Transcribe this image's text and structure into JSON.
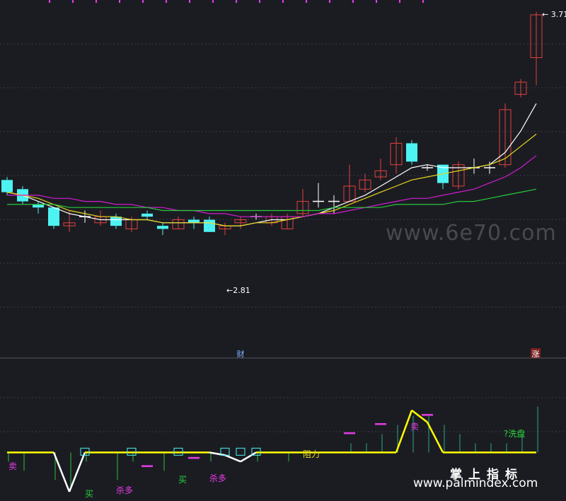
{
  "watermarks": {
    "center": "www.6e70.com",
    "cn": "掌上指标",
    "url": "www.palmindex.com"
  },
  "colors": {
    "background": "#1b1c22",
    "grid": "#3a3d46",
    "up": "#e0413c",
    "down": "#4df2f2",
    "ma_white": "#ffffff",
    "ma_yellow": "#e6d61a",
    "ma_magenta": "#d21bd2",
    "ma_green": "#27c93a",
    "signal_line": "#ffff00",
    "signal_white": "#ffffff",
    "label_magenta": "#e63ce6",
    "label_green": "#27d63a",
    "label_yellow": "#e6d61a",
    "label_caption": "#7fb6ff"
  },
  "chart_data": [
    {
      "type": "candlestick",
      "title": "",
      "ylim": [
        2.62,
        3.74
      ],
      "candles": [
        {
          "o": 3.17,
          "c": 3.13,
          "h": 3.18,
          "l": 3.12
        },
        {
          "o": 3.14,
          "c": 3.1,
          "h": 3.15,
          "l": 3.09
        },
        {
          "o": 3.09,
          "c": 3.08,
          "h": 3.1,
          "l": 3.06
        },
        {
          "o": 3.08,
          "c": 3.02,
          "h": 3.08,
          "l": 3.01
        },
        {
          "o": 3.02,
          "c": 3.03,
          "h": 3.07,
          "l": 3.0
        },
        {
          "o": 3.05,
          "c": 3.05,
          "h": 3.07,
          "l": 3.03
        },
        {
          "o": 3.03,
          "c": 3.05,
          "h": 3.07,
          "l": 3.02
        },
        {
          "o": 3.05,
          "c": 3.02,
          "h": 3.06,
          "l": 3.01
        },
        {
          "o": 3.01,
          "c": 3.04,
          "h": 3.05,
          "l": 3.0
        },
        {
          "o": 3.06,
          "c": 3.05,
          "h": 3.07,
          "l": 3.04
        },
        {
          "o": 3.02,
          "c": 3.01,
          "h": 3.03,
          "l": 2.99
        },
        {
          "o": 3.01,
          "c": 3.04,
          "h": 3.05,
          "l": 3.01
        },
        {
          "o": 3.04,
          "c": 3.03,
          "h": 3.05,
          "l": 3.01
        },
        {
          "o": 3.04,
          "c": 3.0,
          "h": 3.05,
          "l": 3.0
        },
        {
          "o": 3.01,
          "c": 3.02,
          "h": 3.03,
          "l": 2.99
        },
        {
          "o": 3.03,
          "c": 3.04,
          "h": 3.05,
          "l": 3.01
        },
        {
          "o": 3.05,
          "c": 3.05,
          "h": 3.06,
          "l": 3.04
        },
        {
          "o": 3.03,
          "c": 3.05,
          "h": 3.06,
          "l": 3.02
        },
        {
          "o": 3.01,
          "c": 3.05,
          "h": 3.06,
          "l": 3.01
        },
        {
          "o": 3.06,
          "c": 3.1,
          "h": 3.14,
          "l": 3.05
        },
        {
          "o": 3.1,
          "c": 3.1,
          "h": 3.16,
          "l": 3.08
        },
        {
          "o": 3.1,
          "c": 3.1,
          "h": 3.12,
          "l": 3.06
        },
        {
          "o": 3.1,
          "c": 3.15,
          "h": 3.22,
          "l": 3.1
        },
        {
          "o": 3.14,
          "c": 3.17,
          "h": 3.19,
          "l": 3.13
        },
        {
          "o": 3.18,
          "c": 3.2,
          "h": 3.24,
          "l": 3.17
        },
        {
          "o": 3.22,
          "c": 3.29,
          "h": 3.31,
          "l": 3.19
        },
        {
          "o": 3.29,
          "c": 3.23,
          "h": 3.3,
          "l": 3.22
        },
        {
          "o": 3.21,
          "c": 3.21,
          "h": 3.22,
          "l": 3.2
        },
        {
          "o": 3.22,
          "c": 3.16,
          "h": 3.22,
          "l": 3.14
        },
        {
          "o": 3.15,
          "c": 3.22,
          "h": 3.23,
          "l": 3.14
        },
        {
          "o": 3.21,
          "c": 3.21,
          "h": 3.24,
          "l": 3.19
        },
        {
          "o": 3.21,
          "c": 3.21,
          "h": 3.23,
          "l": 3.19
        },
        {
          "o": 3.22,
          "c": 3.4,
          "h": 3.42,
          "l": 3.21
        },
        {
          "o": 3.45,
          "c": 3.49,
          "h": 3.5,
          "l": 3.44
        },
        {
          "o": 3.57,
          "c": 3.71,
          "h": 3.72,
          "l": 3.48
        }
      ],
      "series": [
        {
          "name": "",
          "color": "#ffffff",
          "values": [
            3.13,
            3.12,
            3.1,
            3.08,
            3.06,
            3.05,
            3.04,
            3.04,
            3.04,
            3.04,
            3.03,
            3.03,
            3.03,
            3.03,
            3.02,
            3.02,
            3.03,
            3.04,
            3.04,
            3.05,
            3.06,
            3.08,
            3.1,
            3.12,
            3.15,
            3.18,
            3.21,
            3.22,
            3.21,
            3.21,
            3.21,
            3.22,
            3.26,
            3.33,
            3.42
          ]
        },
        {
          "name": "",
          "color": "#e6d61a",
          "values": [
            3.13,
            3.12,
            3.11,
            3.09,
            3.07,
            3.06,
            3.05,
            3.05,
            3.04,
            3.04,
            3.03,
            3.03,
            3.03,
            3.03,
            3.02,
            3.02,
            3.03,
            3.03,
            3.04,
            3.05,
            3.06,
            3.07,
            3.09,
            3.11,
            3.13,
            3.15,
            3.17,
            3.18,
            3.19,
            3.2,
            3.21,
            3.22,
            3.24,
            3.28,
            3.32
          ]
        },
        {
          "name": "",
          "color": "#d21bd2",
          "values": [
            3.12,
            3.12,
            3.12,
            3.11,
            3.11,
            3.1,
            3.1,
            3.09,
            3.09,
            3.08,
            3.08,
            3.07,
            3.07,
            3.06,
            3.06,
            3.05,
            3.05,
            3.05,
            3.05,
            3.05,
            3.06,
            3.06,
            3.07,
            3.08,
            3.09,
            3.1,
            3.11,
            3.11,
            3.12,
            3.13,
            3.14,
            3.16,
            3.18,
            3.21,
            3.25
          ]
        },
        {
          "name": "",
          "color": "#27c93a",
          "values": [
            3.09,
            3.09,
            3.09,
            3.09,
            3.08,
            3.08,
            3.08,
            3.08,
            3.08,
            3.08,
            3.07,
            3.07,
            3.07,
            3.07,
            3.07,
            3.07,
            3.07,
            3.07,
            3.07,
            3.07,
            3.07,
            3.08,
            3.08,
            3.08,
            3.08,
            3.09,
            3.09,
            3.09,
            3.09,
            3.1,
            3.1,
            3.11,
            3.12,
            3.13,
            3.14
          ]
        }
      ],
      "annotations": {
        "high_label": "3.71",
        "low_label": "2.81",
        "caption_cai": "财",
        "caption_zhang": "涨"
      }
    },
    {
      "type": "bar",
      "title": "",
      "ylim": [
        -5,
        10
      ],
      "values": [
        -1,
        -2,
        0,
        -3,
        -4,
        -1,
        0,
        -3,
        -1,
        0,
        -2,
        0,
        0,
        -1,
        0,
        0,
        -1,
        0,
        -1,
        0,
        0,
        0,
        1,
        1,
        2,
        3,
        4,
        4,
        3,
        2,
        1,
        1,
        1,
        2,
        5
      ],
      "signal_line": [
        0,
        0,
        0,
        0,
        -4.3,
        0,
        0,
        0,
        0,
        0,
        0,
        0,
        0,
        0,
        -0.3,
        -1,
        0,
        0,
        0,
        0,
        0,
        0,
        0,
        0,
        0,
        0,
        4.6,
        3.3,
        0,
        0,
        0,
        0,
        0,
        0,
        0
      ],
      "markers": {
        "boxes": [
          5,
          8,
          11,
          14,
          15,
          16
        ]
      },
      "labels": {
        "sell": "卖",
        "buy": "买",
        "sha_duo": "杀多",
        "zu_li": "阻力",
        "xi_pan": "?洗盘"
      }
    }
  ]
}
